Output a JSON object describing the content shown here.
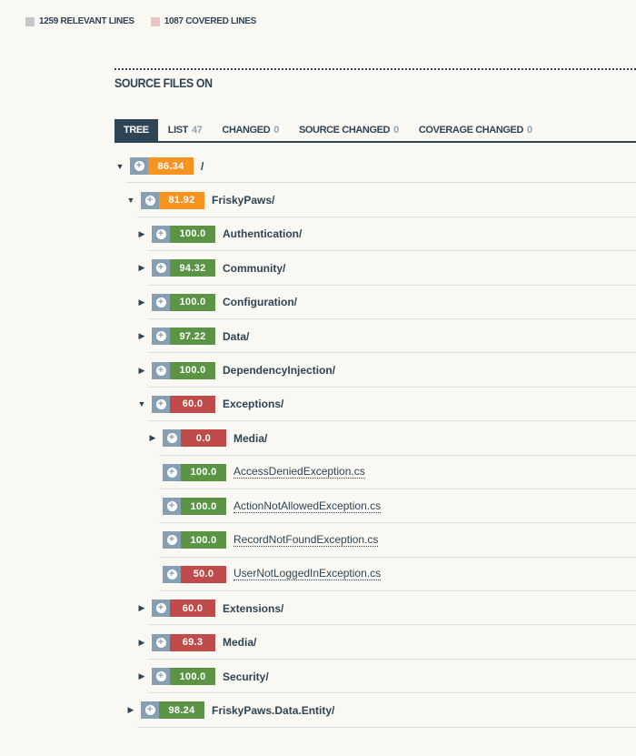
{
  "legend": [
    {
      "label": "1259 RELEVANT LINES",
      "color": "#c3c8ca"
    },
    {
      "label": "1087 COVERED LINES",
      "color": "#e8c5c3"
    }
  ],
  "section_title": "SOURCE FILES ON",
  "tabs": [
    {
      "label": "TREE",
      "count": null,
      "active": true
    },
    {
      "label": "LIST",
      "count": "47",
      "active": false
    },
    {
      "label": "CHANGED",
      "count": "0",
      "active": false
    },
    {
      "label": "SOURCE CHANGED",
      "count": "0",
      "active": false
    },
    {
      "label": "COVERAGE CHANGED",
      "count": "0",
      "active": false
    }
  ],
  "colors": {
    "high": "#5b9444",
    "medium": "#f7931e",
    "low": "#bf4b4b",
    "expand": "#879fb2",
    "text": "#2f4454"
  },
  "tree": [
    {
      "depth": 0,
      "caret": "expanded",
      "coverage": "86.34",
      "level": "medium",
      "name": "/",
      "type": "dir"
    },
    {
      "depth": 1,
      "caret": "expanded",
      "coverage": "81.92",
      "level": "medium",
      "name": "FriskyPaws/",
      "type": "dir"
    },
    {
      "depth": 2,
      "caret": "collapsed",
      "coverage": "100.0",
      "level": "high",
      "name": "Authentication/",
      "type": "dir"
    },
    {
      "depth": 2,
      "caret": "collapsed",
      "coverage": "94.32",
      "level": "high",
      "name": "Community/",
      "type": "dir"
    },
    {
      "depth": 2,
      "caret": "collapsed",
      "coverage": "100.0",
      "level": "high",
      "name": "Configuration/",
      "type": "dir"
    },
    {
      "depth": 2,
      "caret": "collapsed",
      "coverage": "97.22",
      "level": "high",
      "name": "Data/",
      "type": "dir"
    },
    {
      "depth": 2,
      "caret": "collapsed",
      "coverage": "100.0",
      "level": "high",
      "name": "DependencyInjection/",
      "type": "dir"
    },
    {
      "depth": 2,
      "caret": "expanded",
      "coverage": "60.0",
      "level": "low",
      "name": "Exceptions/",
      "type": "dir"
    },
    {
      "depth": 3,
      "caret": "collapsed",
      "coverage": "0.0",
      "level": "low",
      "name": "Media/",
      "type": "dir"
    },
    {
      "depth": 3,
      "caret": "none",
      "coverage": "100.0",
      "level": "high",
      "name": "AccessDeniedException.cs",
      "type": "file"
    },
    {
      "depth": 3,
      "caret": "none",
      "coverage": "100.0",
      "level": "high",
      "name": "ActionNotAllowedException.cs",
      "type": "file"
    },
    {
      "depth": 3,
      "caret": "none",
      "coverage": "100.0",
      "level": "high",
      "name": "RecordNotFoundException.cs",
      "type": "file"
    },
    {
      "depth": 3,
      "caret": "none",
      "coverage": "50.0",
      "level": "low",
      "name": "UserNotLoggedInException.cs",
      "type": "file"
    },
    {
      "depth": 2,
      "caret": "collapsed",
      "coverage": "60.0",
      "level": "low",
      "name": "Extensions/",
      "type": "dir"
    },
    {
      "depth": 2,
      "caret": "collapsed",
      "coverage": "69.3",
      "level": "low",
      "name": "Media/",
      "type": "dir"
    },
    {
      "depth": 2,
      "caret": "collapsed",
      "coverage": "100.0",
      "level": "high",
      "name": "Security/",
      "type": "dir"
    },
    {
      "depth": 1,
      "caret": "collapsed",
      "coverage": "98.24",
      "level": "high",
      "name": "FriskyPaws.Data.Entity/",
      "type": "dir"
    }
  ],
  "icons": {
    "expanded": "▼",
    "collapsed": "▶",
    "plus": "+"
  }
}
